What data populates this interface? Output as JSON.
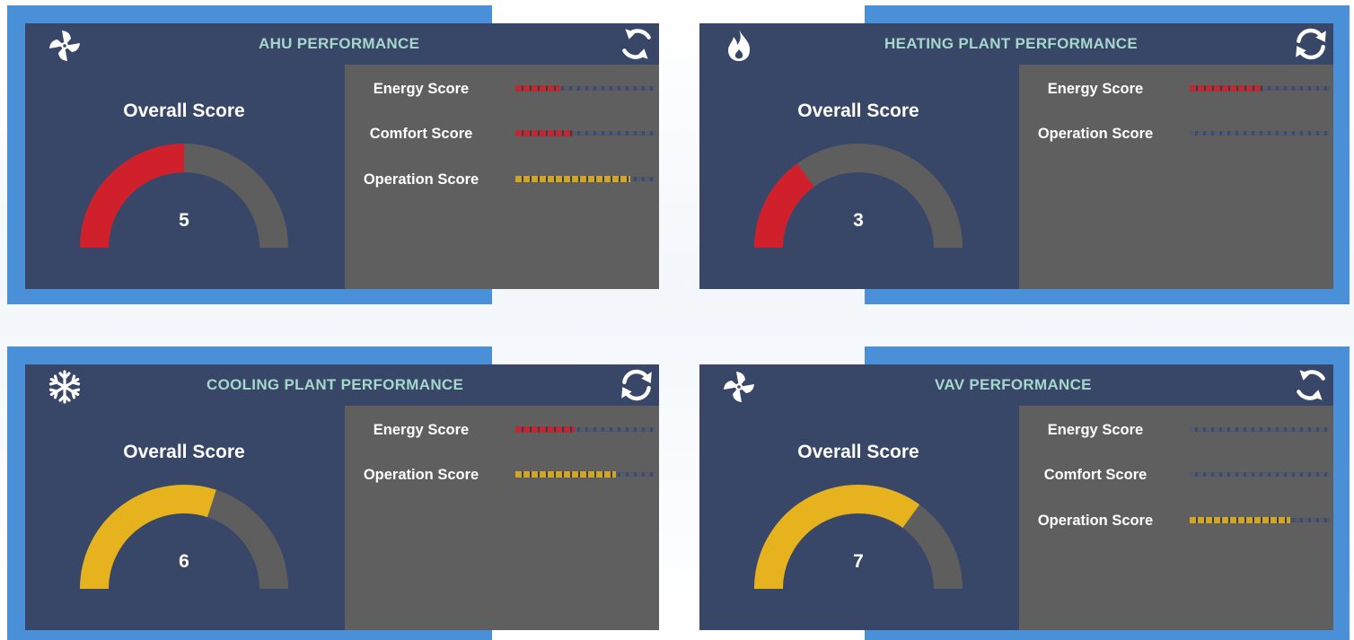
{
  "colors": {
    "accent_blue": "#4a90d9",
    "panel_bg": "#384668",
    "metrics_bg": "#5f5f5f",
    "title_teal": "#a4d8cb",
    "red": "#d0202b",
    "yellow": "#e6b31e",
    "gauge_track": "#5e5e5e"
  },
  "panels": [
    {
      "title": "AHU PERFORMANCE",
      "icon": "fan-icon",
      "overall_label": "Overall Score",
      "score_value": "5",
      "score_fraction": 0.5,
      "score_color": "#d0202b",
      "metrics": [
        {
          "label": "Energy Score",
          "fraction": 0.32,
          "color": "#d0202b"
        },
        {
          "label": "Comfort Score",
          "fraction": 0.41,
          "color": "#d0202b"
        },
        {
          "label": "Operation Score",
          "fraction": 0.82,
          "color": "#e6b31e"
        }
      ]
    },
    {
      "title": "HEATING PLANT PERFORMANCE",
      "icon": "flame-icon",
      "overall_label": "Overall Score",
      "score_value": "3",
      "score_fraction": 0.3,
      "score_color": "#d0202b",
      "metrics": [
        {
          "label": "Energy Score",
          "fraction": 0.52,
          "color": "#d0202b"
        },
        {
          "label": "Operation Score",
          "fraction": 0.0,
          "color": "#d0202b"
        }
      ]
    },
    {
      "title": "COOLING PLANT PERFORMANCE",
      "icon": "snowflake-icon",
      "overall_label": "Overall Score",
      "score_value": "6",
      "score_fraction": 0.6,
      "score_color": "#e6b31e",
      "metrics": [
        {
          "label": "Energy Score",
          "fraction": 0.42,
          "color": "#d0202b"
        },
        {
          "label": "Operation Score",
          "fraction": 0.72,
          "color": "#e6b31e"
        }
      ]
    },
    {
      "title": "VAV PERFORMANCE",
      "icon": "fan-icon",
      "overall_label": "Overall Score",
      "score_value": "7",
      "score_fraction": 0.7,
      "score_color": "#e6b31e",
      "metrics": [
        {
          "label": "Energy Score",
          "fraction": 0.0,
          "color": "#d0202b"
        },
        {
          "label": "Comfort Score",
          "fraction": 0.0,
          "color": "#d0202b"
        },
        {
          "label": "Operation Score",
          "fraction": 0.72,
          "color": "#e6b31e"
        }
      ]
    }
  ]
}
